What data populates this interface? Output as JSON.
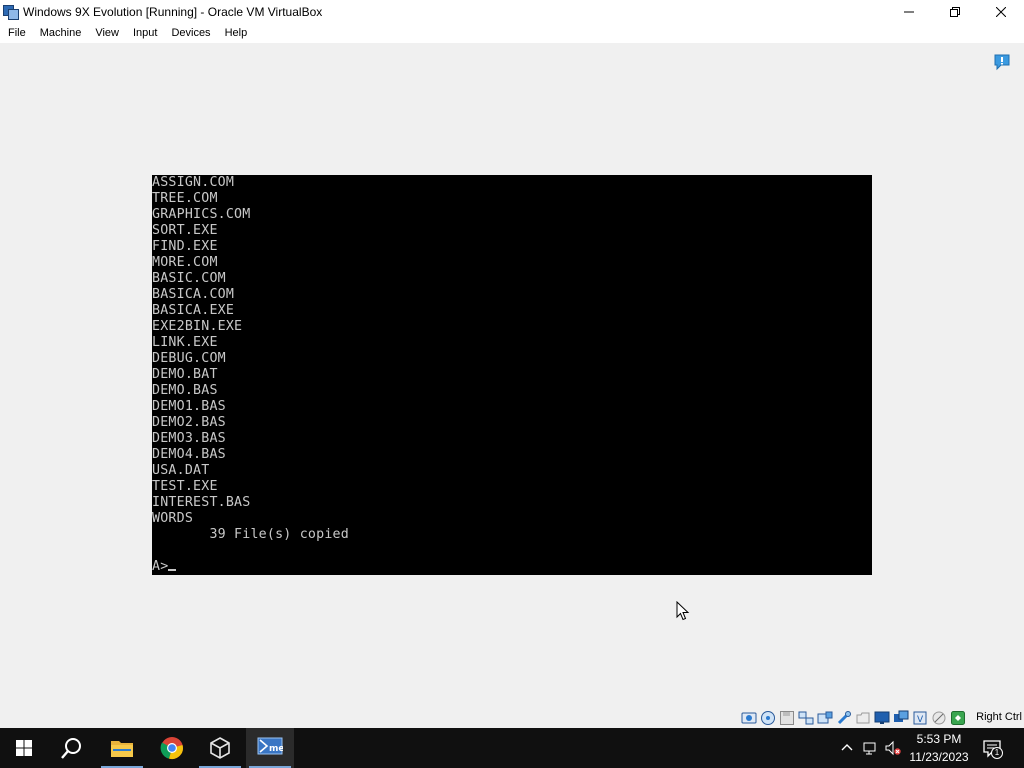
{
  "window": {
    "title": "Windows 9X Evolution [Running] - Oracle VM VirtualBox",
    "controls": [
      "minimize",
      "maximize",
      "close"
    ]
  },
  "menu": {
    "items": [
      "File",
      "Machine",
      "View",
      "Input",
      "Devices",
      "Help"
    ]
  },
  "vm_console": {
    "lines": [
      "ASSIGN.COM",
      "TREE.COM",
      "GRAPHICS.COM",
      "SORT.EXE",
      "FIND.EXE",
      "MORE.COM",
      "BASIC.COM",
      "BASICA.COM",
      "BASICA.EXE",
      "EXE2BIN.EXE",
      "LINK.EXE",
      "DEBUG.COM",
      "DEMO.BAT",
      "DEMO.BAS",
      "DEMO1.BAS",
      "DEMO2.BAS",
      "DEMO3.BAS",
      "DEMO4.BAS",
      "USA.DAT",
      "TEST.EXE",
      "INTEREST.BAS",
      "WORDS",
      "       39 File(s) copied",
      "",
      "A>"
    ]
  },
  "statusbar": {
    "icons": [
      "hard-disk-icon",
      "optical-drive-icon",
      "floppy-icon",
      "network-icon",
      "usb-icon",
      "shared-folders-icon",
      "display-icon",
      "video-capture-icon",
      "vm-monitor-icon",
      "cpu-icon",
      "mouse-integration-icon",
      "keyboard-icon"
    ],
    "host_key": "Right Ctrl"
  },
  "taskbar": {
    "apps": [
      "start-button",
      "search-button",
      "file-explorer",
      "chrome",
      "virtualbox-manager",
      "virtualbox-vm"
    ],
    "time": "5:53 PM",
    "date": "11/23/2023",
    "notification_count": "1"
  },
  "colors": {
    "console_bg": "#000000",
    "console_text": "#c8c8c8",
    "taskbar_bg": "#101010",
    "window_bg": "#f0f0f0"
  }
}
